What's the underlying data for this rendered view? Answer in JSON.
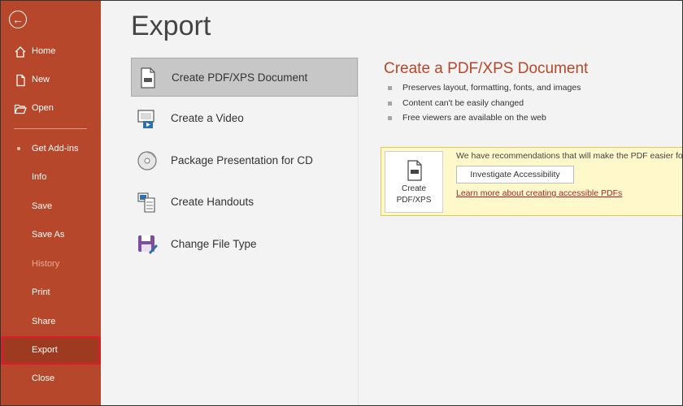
{
  "sidebar": {
    "items": [
      {
        "label": "Home",
        "icon": "home-icon"
      },
      {
        "label": "New",
        "icon": "new-doc-icon"
      },
      {
        "label": "Open",
        "icon": "folder-icon"
      },
      {
        "label": "Get Add-ins",
        "icon": "dot-icon"
      },
      {
        "label": "Info"
      },
      {
        "label": "Save"
      },
      {
        "label": "Save As"
      },
      {
        "label": "History",
        "disabled": true
      },
      {
        "label": "Print"
      },
      {
        "label": "Share"
      },
      {
        "label": "Export",
        "selected": true
      },
      {
        "label": "Close"
      }
    ]
  },
  "main": {
    "title": "Export",
    "options": [
      {
        "label": "Create PDF/XPS Document",
        "icon": "pdf-doc-icon",
        "selected": true
      },
      {
        "label": "Create a Video",
        "icon": "video-icon"
      },
      {
        "label": "Package Presentation for CD",
        "icon": "cd-icon"
      },
      {
        "label": "Create Handouts",
        "icon": "handouts-icon"
      },
      {
        "label": "Change File Type",
        "icon": "file-type-icon"
      }
    ]
  },
  "panel": {
    "title": "Create a PDF/XPS Document",
    "bullets": [
      "Preserves layout, formatting, fonts, and images",
      "Content can't be easily changed",
      "Free viewers are available on the web"
    ],
    "create_tile_line1": "Create",
    "create_tile_line2": "PDF/XPS",
    "recommendation": "We have recommendations that will make the PDF easier fo",
    "investigate_label": "Investigate Accessibility",
    "learn_more": "Learn more about creating accessible PDFs"
  },
  "colors": {
    "sidebar": "#b7472a",
    "accent": "#b7472a",
    "highlight_border": "#e2192e",
    "info_bg": "#fff8cb"
  }
}
